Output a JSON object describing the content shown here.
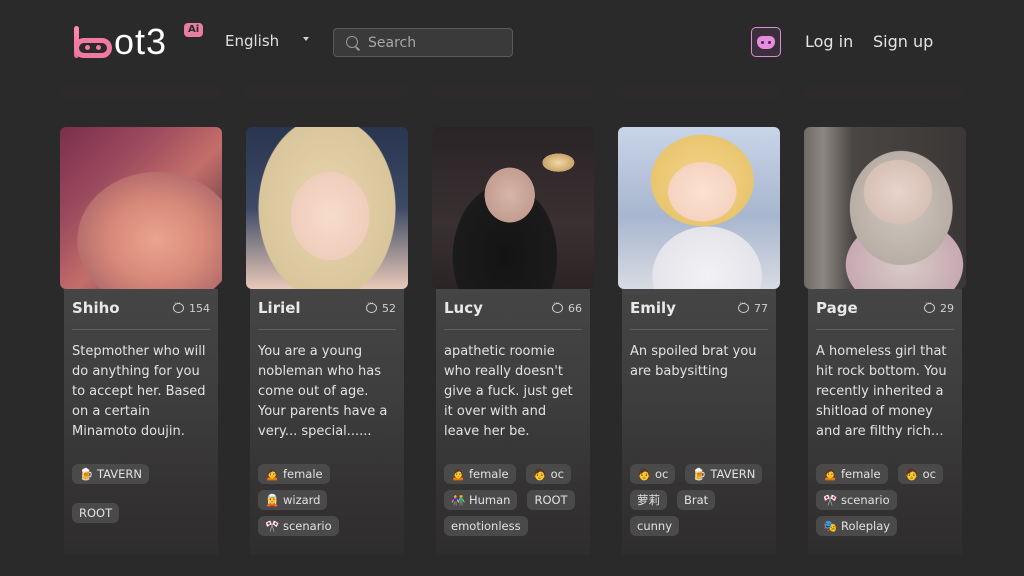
{
  "header": {
    "logo_text": "ot3",
    "logo_badge": "Ai",
    "language": "English",
    "search_placeholder": "Search",
    "login_label": "Log in",
    "signup_label": "Sign up",
    "accent_color": "#e97ea3",
    "discord_color": "#e58be0"
  },
  "cards": [
    {
      "name": "Shiho",
      "chats": "154",
      "description": "Stepmother who will do anything for you to accept her. Based on a certain Minamoto doujin.",
      "tags": [
        "🍺 TAVERN",
        "ROOT"
      ]
    },
    {
      "name": "Liriel",
      "chats": "52",
      "description": "You are a young nobleman who has come out of age. Your parents have a very... special......",
      "tags": [
        "🙍 female",
        "🧝 wizard",
        "🎌 scenario"
      ]
    },
    {
      "name": "Lucy",
      "chats": "66",
      "description": "apathetic roomie who really doesn't give a fuck. just get it over with and leave her be.",
      "tags": [
        "🙍 female",
        "🧑 oc",
        "👫 Human",
        "ROOT",
        "emotionless"
      ]
    },
    {
      "name": "Emily",
      "chats": "77",
      "description": "An spoiled brat you are babysitting",
      "tags": [
        "🧑 oc",
        "🍺 TAVERN",
        "萝莉",
        "Brat",
        "cunny"
      ]
    },
    {
      "name": "Page",
      "chats": "29",
      "description": "A homeless girl that hit rock bottom. You recently inherited a shitload of money and are filthy rich...",
      "tags": [
        "🙍 female",
        "🧑 oc",
        "🎌 scenario",
        "🎭 Roleplay"
      ]
    }
  ]
}
